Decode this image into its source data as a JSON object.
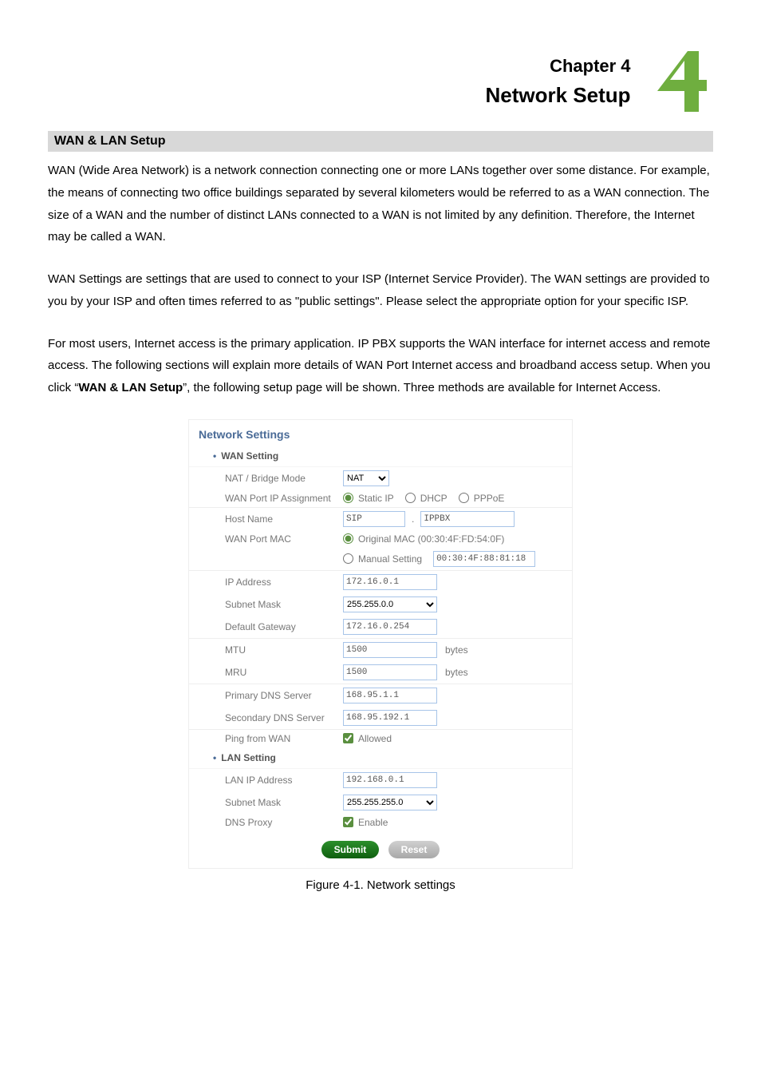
{
  "chapter": {
    "line1": "Chapter 4",
    "line2": "Network Setup"
  },
  "section_title": "WAN & LAN Setup",
  "para1": "WAN (Wide Area Network) is a network connection connecting one or more LANs together over some distance. For example, the means of connecting two office buildings separated by several kilometers would be referred to as a WAN connection. The size of a WAN and the number of distinct LANs connected to a WAN is not limited by any definition. Therefore, the Internet may be called a WAN.",
  "para2": "WAN Settings are settings that are used to connect to your ISP (Internet Service Provider). The WAN settings are provided to you by your ISP and often times referred to as \"public settings\". Please select the appropriate option for your specific ISP.",
  "para3_pre": "For most users, Internet access is the primary application. IP PBX supports the WAN interface for internet access and remote access. The following sections will explain more details of WAN Port Internet access and broadband access setup. When you click “",
  "para3_bold": "WAN & LAN Setup",
  "para3_post": "”, the following setup page will be shown. Three methods are available for Internet Access.",
  "panel": {
    "title": "Network Settings",
    "wan_heading": "WAN Setting",
    "lan_heading": "LAN Setting",
    "labels": {
      "nat_bridge": "NAT / Bridge Mode",
      "wan_assign": "WAN Port IP Assignment",
      "host": "Host Name",
      "wan_mac": "WAN Port MAC",
      "ip": "IP Address",
      "subnet": "Subnet Mask",
      "gateway": "Default Gateway",
      "mtu": "MTU",
      "mru": "MRU",
      "dns1": "Primary DNS Server",
      "dns2": "Secondary DNS Server",
      "ping": "Ping from WAN",
      "lan_ip": "LAN IP Address",
      "lan_subnet": "Subnet Mask",
      "dns_proxy": "DNS Proxy"
    },
    "values": {
      "nat_bridge": "NAT",
      "assign_static": "Static IP",
      "assign_dhcp": "DHCP",
      "assign_pppoe": "PPPoE",
      "host_a": "SIP",
      "host_b": "IPPBX",
      "mac_orig": "Original MAC (00:30:4F:FD:54:0F)",
      "mac_manual": "Manual Setting",
      "mac_manual_val": "00:30:4F:88:81:18",
      "ip": "172.16.0.1",
      "subnet": "255.255.0.0",
      "gateway": "172.16.0.254",
      "mtu": "1500",
      "mru": "1500",
      "unit": "bytes",
      "dns1": "168.95.1.1",
      "dns2": "168.95.192.1",
      "allowed": "Allowed",
      "lan_ip": "192.168.0.1",
      "lan_subnet": "255.255.255.0",
      "enable": "Enable"
    },
    "buttons": {
      "submit": "Submit",
      "reset": "Reset"
    }
  },
  "figure_caption": "Figure 4-1. Network settings"
}
